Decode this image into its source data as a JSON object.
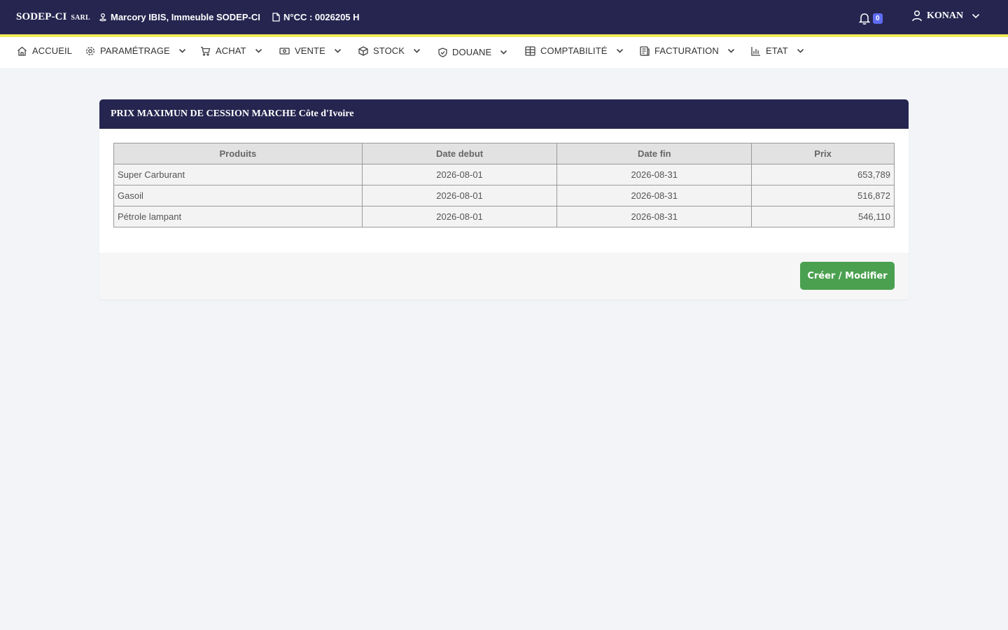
{
  "topbar": {
    "brand": "SODEP-CI",
    "brand_suffix": "SARL",
    "address": "Marcory IBIS, Immeuble SODEP-CI",
    "ncc": "N°CC : 0026205 H",
    "notification_count": "0",
    "user_name": "KONAN"
  },
  "nav": {
    "items": [
      {
        "label": "ACCUEIL",
        "icon": "home-icon"
      },
      {
        "label": "PARAMÉTRAGE",
        "icon": "gear-icon"
      },
      {
        "label": "ACHAT",
        "icon": "cart-icon"
      },
      {
        "label": "VENTE",
        "icon": "money-icon"
      },
      {
        "label": "STOCK",
        "icon": "box-icon"
      },
      {
        "label": "DOUANE",
        "icon": "shield-icon"
      },
      {
        "label": "COMPTABILITÉ",
        "icon": "ledger-icon"
      },
      {
        "label": "FACTURATION",
        "icon": "invoice-icon"
      },
      {
        "label": "ETAT",
        "icon": "chart-icon"
      }
    ]
  },
  "card": {
    "title": "PRIX MAXIMUN DE CESSION MARCHE Côte d'Ivoire",
    "columns": [
      "Produits",
      "Date debut",
      "Date fin",
      "Prix"
    ],
    "rows": [
      {
        "product": "Super Carburant",
        "start": "2026-08-01",
        "end": "2026-08-31",
        "price": "653,789"
      },
      {
        "product": "Gasoil",
        "start": "2026-08-01",
        "end": "2026-08-31",
        "price": "516,872"
      },
      {
        "product": "Pétrole lampant",
        "start": "2026-08-01",
        "end": "2026-08-31",
        "price": "546,110"
      }
    ],
    "button_label": "Créer / Modifier"
  },
  "colors": {
    "header_bg": "#252550",
    "accent_stripe": "#f2ec5c",
    "button_green": "#4aa04f",
    "badge_blue": "#5f6cf2"
  }
}
